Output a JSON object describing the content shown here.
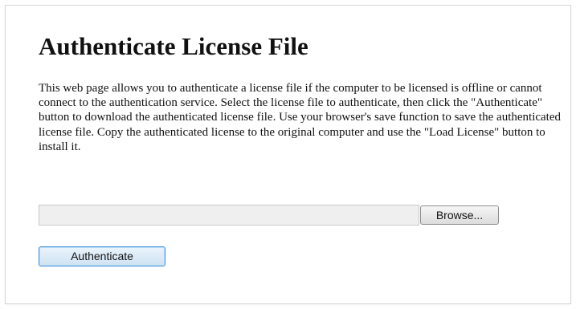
{
  "page": {
    "title": "Authenticate License File",
    "description": "This web page allows you to authenticate a license file if the computer to be licensed is offline or cannot connect to the authentication service. Select the license file to authenticate, then click the \"Authenticate\" button to download the authenticated license file. Use your browser's save function to save the authenticated license file. Copy the authenticated license to the original computer and use the \"Load License\" button to install it."
  },
  "file_input": {
    "value": "",
    "browse_label": "Browse..."
  },
  "actions": {
    "authenticate_label": "Authenticate"
  },
  "colors": {
    "focus_border": "#3c8fd4",
    "panel_border": "#d7d7d7",
    "input_background": "#efefef"
  }
}
